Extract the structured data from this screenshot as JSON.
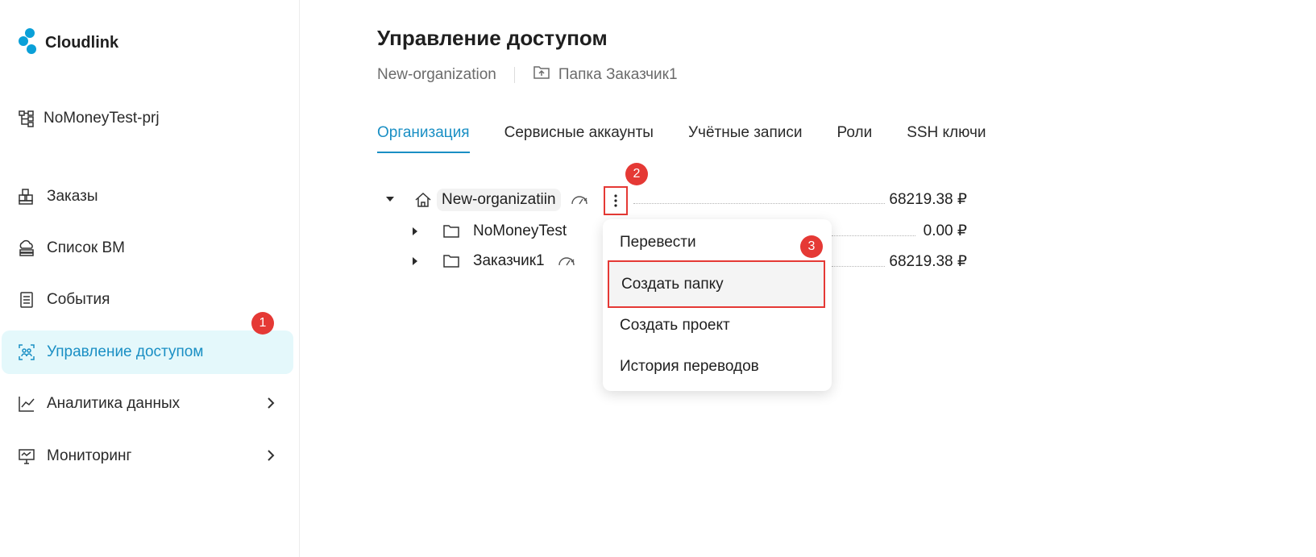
{
  "app": {
    "name": "Cloudlink",
    "logo_icon": "cloudlink-logo"
  },
  "project": {
    "name": "NoMoneyTest-prj",
    "icon": "project-tree-icon"
  },
  "sidebar": {
    "items": [
      {
        "label": "Заказы",
        "icon": "orders-icon"
      },
      {
        "label": "Список ВМ",
        "icon": "cloud-vm-icon"
      },
      {
        "label": "События",
        "icon": "events-icon"
      },
      {
        "label": "Управление доступом",
        "icon": "access-icon",
        "active": true
      },
      {
        "label": "Аналитика данных",
        "icon": "chart-icon",
        "has_submenu": true
      },
      {
        "label": "Мониторинг",
        "icon": "monitor-icon",
        "has_submenu": true
      }
    ]
  },
  "page": {
    "title": "Управление доступом",
    "breadcrumb": {
      "org": "New-organization",
      "folder": "Папка Заказчик1"
    }
  },
  "tabs": [
    "Организация",
    "Сервисные аккаунты",
    "Учётные записи",
    "Роли",
    "SSH ключи"
  ],
  "active_tab": "Организация",
  "tree": {
    "root": {
      "name": "New-organizatiin",
      "amount": "68219.38 ₽"
    },
    "children": [
      {
        "name": "NoMoneyTest",
        "amount": "0.00 ₽"
      },
      {
        "name": "Заказчик1",
        "amount": "68219.38 ₽"
      }
    ]
  },
  "menu": {
    "items": [
      "Перевести",
      "Создать папку",
      "Создать проект",
      "История переводов"
    ],
    "highlighted": "Создать папку"
  },
  "markers": [
    "1",
    "2",
    "3"
  ],
  "colors": {
    "accent": "#1a8fc4",
    "active_bg": "#e4f8fb",
    "marker": "#e53935"
  }
}
